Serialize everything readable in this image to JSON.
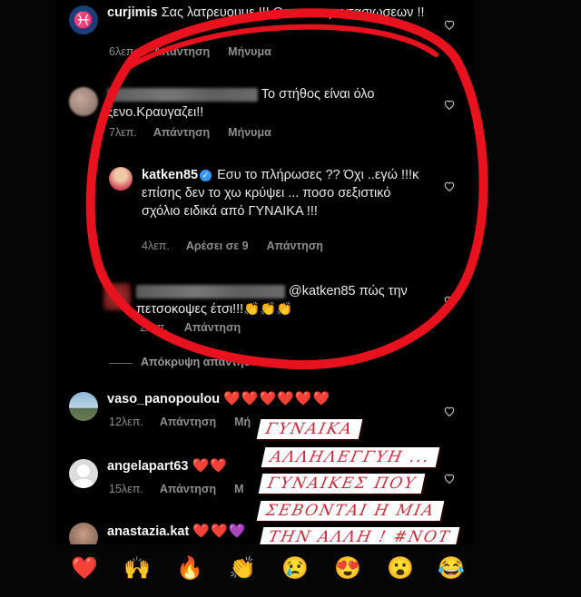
{
  "comments": [
    {
      "username": "curjimis",
      "text": "Σας λατρευουμε !!! Θεα των φαντασιωσεων !!",
      "time": "6λεπ.",
      "reply": "Απάντηση",
      "message": "Μήνυμα"
    },
    {
      "username": "",
      "text": "Το στήθος είναι όλο ξενο.Κραυγαζει!!",
      "time": "7λεπ.",
      "reply": "Απάντηση",
      "message": "Μήνυμα"
    },
    {
      "username": "katken85",
      "text": "Εσυ το πλήρωσες ?? Όχι ..εγώ !!!κ επίσης δεν το χω κρύψει ... ποσο σεξιστικό σχόλιο ειδικά από ΓΥΝΑΙΚΑ !!!",
      "time": "4λεπ.",
      "likes": "Αρέσει σε 9",
      "reply": "Απάντηση"
    },
    {
      "username": "",
      "text": "@katken85 πώς την πετσοκοψες έτσι!!!👏👏👏",
      "time": "2λεπ.",
      "reply": "Απάντηση"
    },
    {
      "username": "vaso_panopoulou",
      "text": "❤️❤️❤️❤️❤️❤️",
      "time": "12λεπ.",
      "reply": "Απάντηση",
      "message": "Μή"
    },
    {
      "username": "angelapart63",
      "text": "❤️❤️",
      "time": "15λεπ.",
      "reply": "Απάντηση",
      "message": "Μ"
    },
    {
      "username": "anastazia.kat",
      "text": "❤️❤️💜"
    }
  ],
  "hide_replies": "Απόκρυψη απαντήσεων",
  "overlay_lines": [
    "ΓΥΝΑΙΚΑ",
    "ΑΛΛΗΛΕΓΓΥΗ ...",
    "ΓΥΝΑΙΚΕΣ ΠΟΥ",
    "ΣΕΒΟΝΤΑΙ Η ΜΙΑ",
    "ΤΗΝ ΑΛΛΗ ! #NOT"
  ],
  "reactions": [
    "❤️",
    "🙌",
    "🔥",
    "👏",
    "😢",
    "😍",
    "😮",
    "😂"
  ],
  "colors": {
    "accent_red": "#e8121f",
    "verified_blue": "#3897f0",
    "overlay_text": "#c62f3d"
  }
}
